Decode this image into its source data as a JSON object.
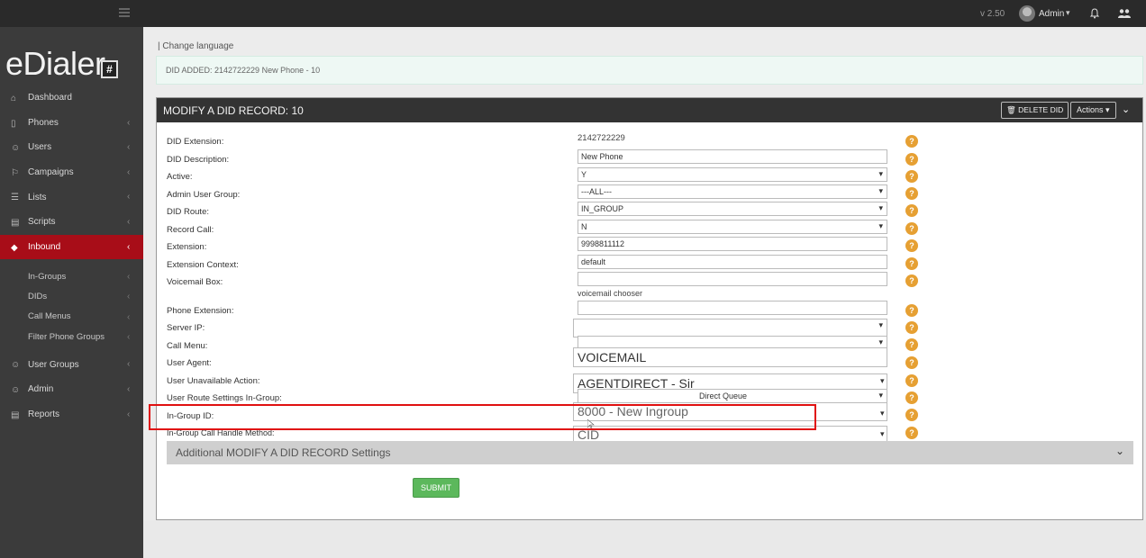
{
  "topbar": {
    "version": "v 2.50",
    "user": "Admin"
  },
  "sidebar": {
    "logo": "eDialer",
    "logo_mark": "#",
    "items": [
      {
        "label": "Dashboard",
        "icon": "dashboard-icon"
      },
      {
        "label": "Phones",
        "icon": "phone-icon"
      },
      {
        "label": "Users",
        "icon": "users-icon"
      },
      {
        "label": "Campaigns",
        "icon": "flag-icon"
      },
      {
        "label": "Lists",
        "icon": "list-icon"
      },
      {
        "label": "Scripts",
        "icon": "script-icon"
      },
      {
        "label": "Inbound",
        "icon": "diamond-icon",
        "active": true
      },
      {
        "label": "User Groups",
        "icon": "user-group-icon"
      },
      {
        "label": "Admin",
        "icon": "admin-icon"
      },
      {
        "label": "Reports",
        "icon": "reports-icon"
      }
    ],
    "inbound_sub": [
      "In-Groups",
      "DIDs",
      "Call Menus",
      "Filter Phone Groups"
    ]
  },
  "main": {
    "change_language": "| Change language",
    "alert": "DID ADDED: 2142722229 New Phone - 10",
    "panel_title": "MODIFY A DID RECORD: 10",
    "delete_button": "DELETE DID",
    "actions_button": "Actions",
    "fields": {
      "did_extension_label": "DID Extension:",
      "did_extension_value": "2142722229",
      "did_description_label": "DID Description:",
      "did_description_value": "New Phone",
      "active_label": "Active:",
      "active_value": "Y",
      "admin_user_group_label": "Admin User Group:",
      "admin_user_group_value": "---ALL---",
      "did_route_label": "DID Route:",
      "did_route_value": "IN_GROUP",
      "record_call_label": "Record Call:",
      "record_call_value": "N",
      "extension_label": "Extension:",
      "extension_value": "9998811112",
      "extension_context_label": "Extension Context:",
      "extension_context_value": "default",
      "voicemail_box_label": "Voicemail Box:",
      "voicemail_chooser": "voicemail chooser",
      "phone_extension_label": "Phone Extension:",
      "server_ip_label": "Server IP:",
      "call_menu_label": "Call Menu:",
      "user_agent_label": "User Agent:",
      "user_agent_value": "VOICEMAIL",
      "user_unavailable_label": "User Unavailable Action:",
      "user_unavailable_value": "AGENTDIRECT - Sir",
      "user_route_label": "User Route Settings In-Group:",
      "user_route_value": "Direct Queue",
      "ingroup_id_label": "In-Group ID:",
      "ingroup_id_value": "8000 - New Ingroup",
      "ingroup_method_label": "In-Group Call Handle Method:",
      "ingroup_method_value": "CID"
    },
    "help_glyph": "?",
    "additional_settings": "Additional MODIFY A DID RECORD Settings",
    "submit": "SUBMIT"
  },
  "colors": {
    "active_nav": "#a80d18",
    "help": "#e6a033",
    "submit": "#5cb85c",
    "highlight": "#e01010"
  }
}
